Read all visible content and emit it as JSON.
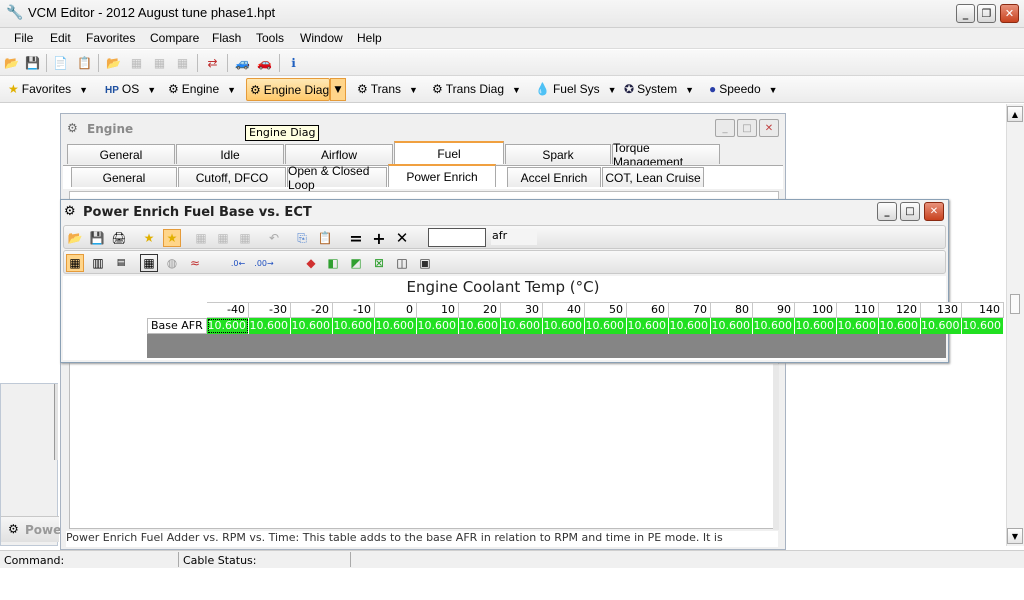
{
  "app": {
    "title": "VCM Editor - 2012 August tune phase1.hpt"
  },
  "menu": [
    "File",
    "Edit",
    "Favorites",
    "Compare",
    "Flash",
    "Tools",
    "Window",
    "Help"
  ],
  "toolbar2": {
    "items": [
      {
        "label": "Favorites",
        "icon": "star-icon"
      },
      {
        "label": "OS",
        "icon": "hp-icon"
      },
      {
        "label": "Engine",
        "icon": "engine-icon"
      },
      {
        "label": "Engine Diag",
        "icon": "engine-diag-icon"
      },
      {
        "label": "Trans",
        "icon": "trans-icon"
      },
      {
        "label": "Trans Diag",
        "icon": "trans-diag-icon"
      },
      {
        "label": "Fuel Sys",
        "icon": "fuel-drop-icon"
      },
      {
        "label": "System",
        "icon": "system-icon"
      },
      {
        "label": "Speedo",
        "icon": "speedo-icon"
      }
    ]
  },
  "tooltip": "Engine Diag",
  "engine_window": {
    "title": "Engine",
    "tabs_row1": [
      "General",
      "Idle",
      "Airflow",
      "Fuel",
      "Spark",
      "Torque Management"
    ],
    "active_row1": "Fuel",
    "tabs_row2": [
      "General",
      "Cutoff, DFCO",
      "Open & Closed Loop",
      "Power Enrich",
      "Accel Enrich",
      "COT, Lean Cruise"
    ],
    "active_row2": "Power Enrich",
    "description": "Power Enrich Fuel Adder vs. RPM vs. Time: This table adds to the base AFR in relation to RPM and time in PE mode. It is"
  },
  "side_window": {
    "label": "Powe"
  },
  "pe_window": {
    "title": "Power Enrich Fuel Base vs. ECT",
    "units_value": "",
    "units_label": "afr",
    "axis_title": "Engine Coolant Temp (°C)",
    "row_label": "Base AFR",
    "columns": [
      "-40",
      "-30",
      "-20",
      "-10",
      "0",
      "10",
      "20",
      "30",
      "40",
      "50",
      "60",
      "70",
      "80",
      "90",
      "100",
      "110",
      "120",
      "130",
      "140"
    ],
    "values": [
      "10.600",
      "10.600",
      "10.600",
      "10.600",
      "10.600",
      "10.600",
      "10.600",
      "10.600",
      "10.600",
      "10.600",
      "10.600",
      "10.600",
      "10.600",
      "10.600",
      "10.600",
      "10.600",
      "10.600",
      "10.600",
      "10.600"
    ],
    "cell_color": "#21e021"
  },
  "statusbar": {
    "command_label": "Command:",
    "cable_label": "Cable Status:"
  }
}
